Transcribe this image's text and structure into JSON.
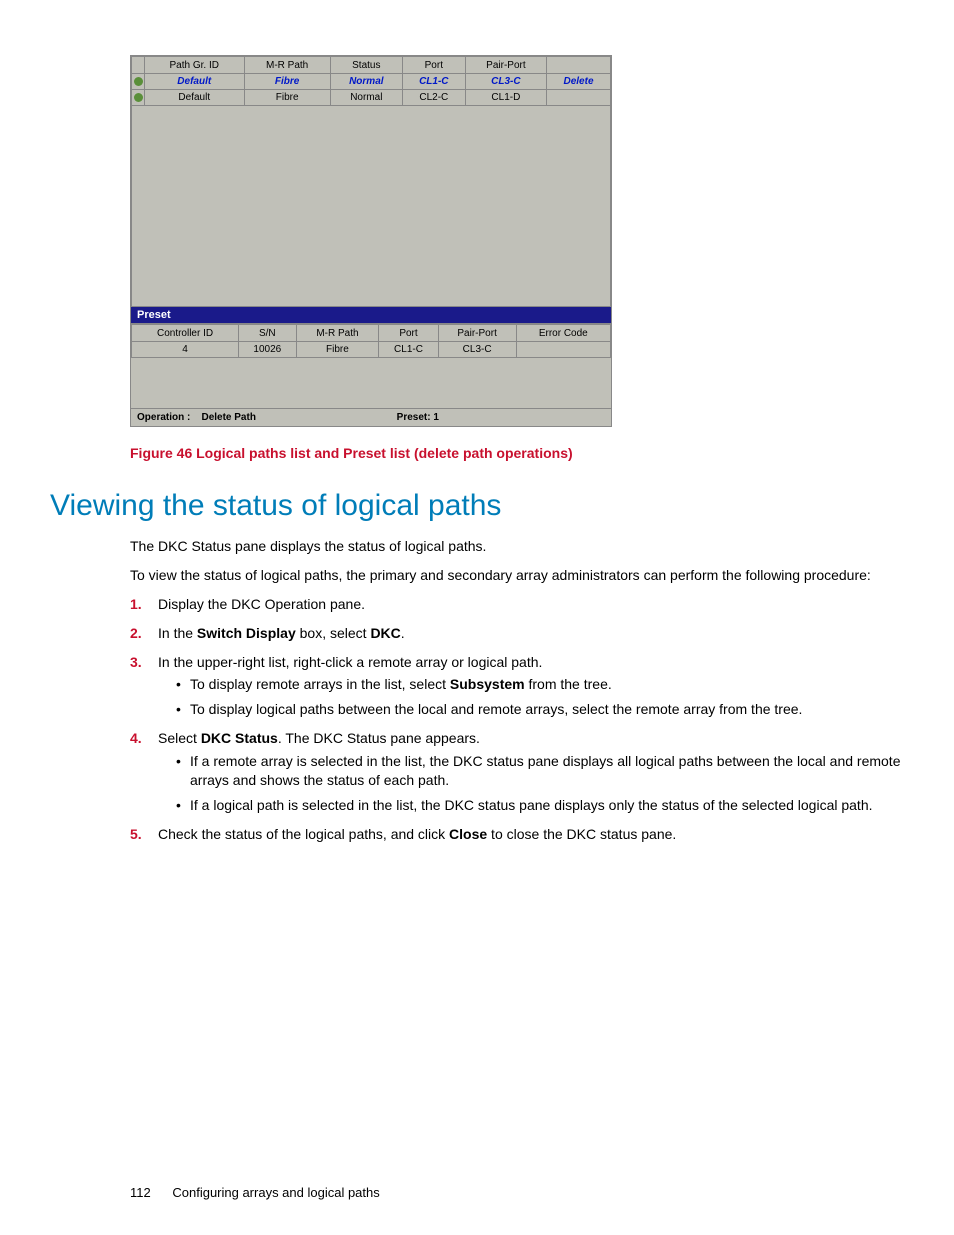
{
  "figure": {
    "upper_table": {
      "headers": [
        "Path Gr. ID",
        "M-R Path",
        "Status",
        "Port",
        "Pair-Port",
        ""
      ],
      "rows": [
        {
          "selected": true,
          "path_gr_id": "Default",
          "mr_path": "Fibre",
          "status": "Normal",
          "port": "CL1-C",
          "pair_port": "CL3-C",
          "action": "Delete"
        },
        {
          "selected": false,
          "path_gr_id": "Default",
          "mr_path": "Fibre",
          "status": "Normal",
          "port": "CL2-C",
          "pair_port": "CL1-D",
          "action": ""
        }
      ]
    },
    "preset_label": "Preset",
    "lower_table": {
      "headers": [
        "Controller ID",
        "S/N",
        "M-R Path",
        "Port",
        "Pair-Port",
        "Error Code"
      ],
      "rows": [
        {
          "controller_id": "4",
          "sn": "10026",
          "mr_path": "Fibre",
          "port": "CL1-C",
          "pair_port": "CL3-C",
          "error_code": ""
        }
      ]
    },
    "status": {
      "operation_label": "Operation :",
      "operation_value": "Delete Path",
      "preset_label": "Preset: 1"
    },
    "caption": "Figure 46 Logical paths list and Preset list (delete path operations)"
  },
  "section": {
    "heading": "Viewing the status of logical paths",
    "intro1": "The DKC Status pane displays the status of logical paths.",
    "intro2": "To view the status of logical paths, the primary and secondary array administrators can perform the following procedure:",
    "steps": [
      {
        "num": "1.",
        "text": "Display the DKC Operation pane."
      },
      {
        "num": "2.",
        "prefix": "In the ",
        "bold1": "Switch Display",
        "mid": " box, select ",
        "bold2": "DKC",
        "suffix": "."
      },
      {
        "num": "3.",
        "text": "In the upper-right list, right-click a remote array or logical path.",
        "sub": [
          {
            "pre": "To display remote arrays in the list, select ",
            "bold": "Subsystem",
            "post": " from the tree."
          },
          {
            "text": "To display logical paths between the local and remote arrays, select the remote array from the tree."
          }
        ]
      },
      {
        "num": "4.",
        "prefix": "Select ",
        "bold1": "DKC Status",
        "suffix": ".  The DKC Status pane appears.",
        "sub": [
          {
            "text": "If a remote array is selected in the list, the DKC status pane displays all logical paths between the local and remote arrays and shows the status of each path."
          },
          {
            "text": "If a logical path is selected in the list, the DKC status pane displays only the status of the selected logical path."
          }
        ]
      },
      {
        "num": "5.",
        "prefix": "Check the status of the logical paths, and click ",
        "bold1": "Close",
        "suffix": " to close the DKC status pane."
      }
    ]
  },
  "footer": {
    "page": "112",
    "chapter": "Configuring arrays and logical paths"
  }
}
